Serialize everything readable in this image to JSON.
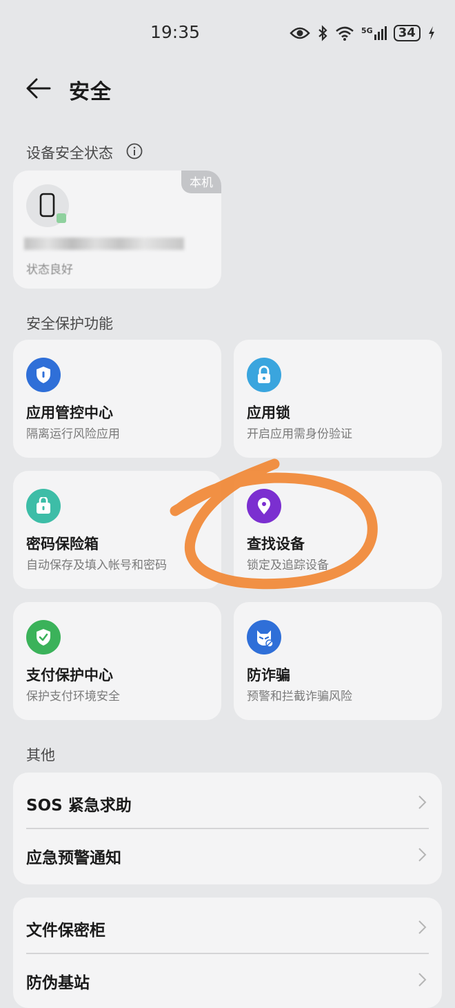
{
  "status_bar": {
    "time": "19:35",
    "network": "5G",
    "battery": "34"
  },
  "header": {
    "title": "安全"
  },
  "device_section": {
    "label": "设备安全状态",
    "tag": "本机",
    "status": "状态良好"
  },
  "protection_section": {
    "label": "安全保护功能",
    "items": [
      {
        "title": "应用管控中心",
        "subtitle": "隔离运行风险应用",
        "icon": "shield-icon",
        "color": "#2f6fd8"
      },
      {
        "title": "应用锁",
        "subtitle": "开启应用需身份验证",
        "icon": "lock-icon",
        "color": "#3aa5de"
      },
      {
        "title": "密码保险箱",
        "subtitle": "自动保存及填入帐号和密码",
        "icon": "safe-box-icon",
        "color": "#3dbda7"
      },
      {
        "title": "查找设备",
        "subtitle": "锁定及追踪设备",
        "icon": "location-pin-icon",
        "color": "#7b2fd0"
      },
      {
        "title": "支付保护中心",
        "subtitle": "保护支付环境安全",
        "icon": "shield-check-icon",
        "color": "#3bb25a"
      },
      {
        "title": "防诈骗",
        "subtitle": "预警和拦截诈骗风险",
        "icon": "anti-fraud-icon",
        "color": "#2f6fd8"
      }
    ]
  },
  "other_section": {
    "label": "其他",
    "group1": [
      "SOS 紧急求助",
      "应急预警通知"
    ],
    "group2": [
      "文件保密柜",
      "防伪基站"
    ]
  },
  "annotation": {
    "color": "#f08a3a"
  }
}
